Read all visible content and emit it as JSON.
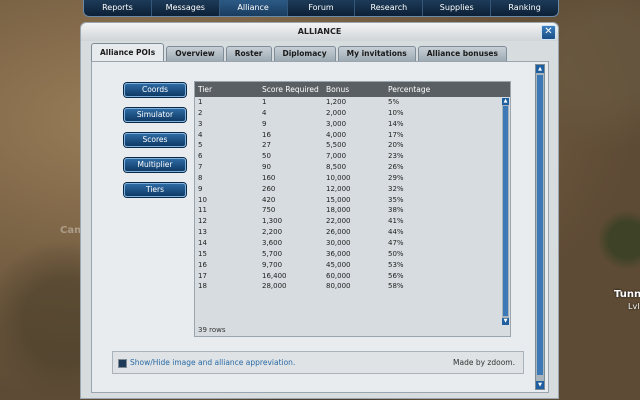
{
  "nav": [
    "Reports",
    "Messages",
    "Alliance",
    "Forum",
    "Research",
    "Supplies",
    "Ranking"
  ],
  "nav_active": "Alliance",
  "window_title": "ALLIANCE",
  "close_glyph": "✕",
  "tabs": [
    "Alliance POIs",
    "Overview",
    "Roster",
    "Diplomacy",
    "My invitations",
    "Alliance bonuses"
  ],
  "active_tab": "Alliance POIs",
  "sidebar": [
    "Coords",
    "Simulator",
    "Scores",
    "Multiplier",
    "Tiers"
  ],
  "table": {
    "headers": [
      "Tier",
      "Score Required",
      "Bonus",
      "Percentage"
    ],
    "rows": [
      [
        "1",
        "1",
        "1,200",
        "5%"
      ],
      [
        "2",
        "4",
        "2,000",
        "10%"
      ],
      [
        "3",
        "9",
        "3,000",
        "14%"
      ],
      [
        "4",
        "16",
        "4,000",
        "17%"
      ],
      [
        "5",
        "27",
        "5,500",
        "20%"
      ],
      [
        "6",
        "50",
        "7,000",
        "23%"
      ],
      [
        "7",
        "90",
        "8,500",
        "26%"
      ],
      [
        "8",
        "160",
        "10,000",
        "29%"
      ],
      [
        "9",
        "260",
        "12,000",
        "32%"
      ],
      [
        "10",
        "420",
        "15,000",
        "35%"
      ],
      [
        "11",
        "750",
        "18,000",
        "38%"
      ],
      [
        "12",
        "1,300",
        "22,000",
        "41%"
      ],
      [
        "13",
        "2,200",
        "26,000",
        "44%"
      ],
      [
        "14",
        "3,600",
        "30,000",
        "47%"
      ],
      [
        "15",
        "5,700",
        "36,000",
        "50%"
      ],
      [
        "16",
        "9,700",
        "45,000",
        "53%"
      ],
      [
        "17",
        "16,400",
        "60,000",
        "56%"
      ],
      [
        "18",
        "28,000",
        "80,000",
        "58%"
      ]
    ],
    "row_count": "39 rows"
  },
  "footer": {
    "checkbox_label": "Show/Hide image and alliance appreviation.",
    "made_by": "Made by zdoom."
  },
  "map_labels": {
    "ghost": "Camp",
    "tunn": "Tunn",
    "lv": "Lvl"
  },
  "colors": {
    "nav_bg": "#0d2036",
    "button_blue": "#2d6aa3",
    "header_bg": "#5a5f63"
  }
}
